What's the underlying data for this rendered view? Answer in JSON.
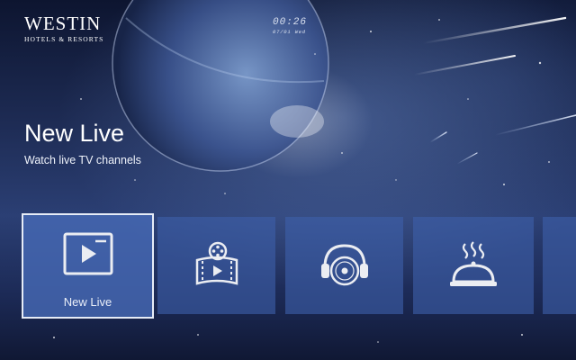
{
  "brand": {
    "name": "WESTIN",
    "subtitle": "HOTELS & RESORTS"
  },
  "clock": {
    "time": "00:26",
    "date": "07/01 Wed"
  },
  "hero": {
    "title": "New Live",
    "subtitle": "Watch live TV channels"
  },
  "tiles": [
    {
      "label": "New Live",
      "icon": "tv-play-icon",
      "selected": true
    },
    {
      "label": "",
      "icon": "film-reel-icon",
      "selected": false
    },
    {
      "label": "",
      "icon": "headphones-music-icon",
      "selected": false
    },
    {
      "label": "",
      "icon": "room-service-cloche-icon",
      "selected": false
    },
    {
      "label": "",
      "icon": "",
      "selected": false
    }
  ],
  "colors": {
    "tile": "#3e60aa",
    "tile_selected": "#486cb9",
    "selected_border": "#e6ecf7",
    "icon": "#ebedf2"
  }
}
